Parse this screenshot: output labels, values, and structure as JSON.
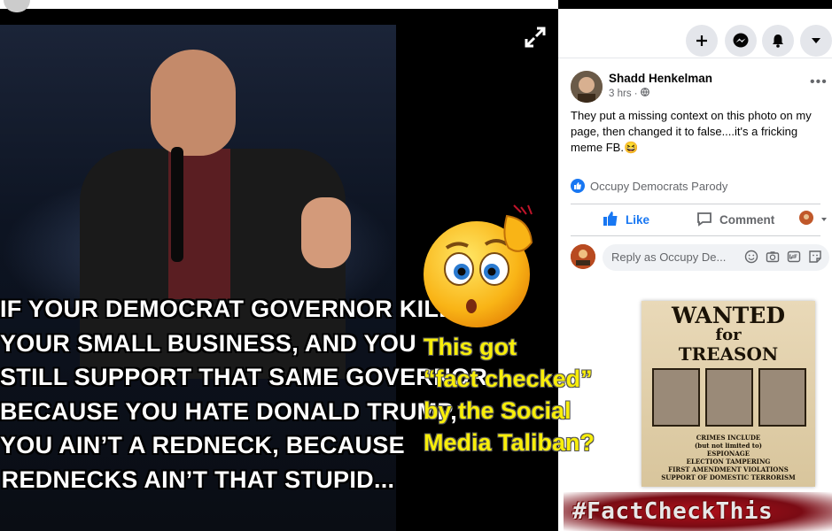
{
  "photo": {
    "meme_lines": [
      "IF YOUR DEMOCRAT GOVERNOR KILLED",
      "YOUR SMALL BUSINESS, AND YOU",
      "STILL SUPPORT THAT SAME GOVERNOR",
      "BECAUSE YOU HATE DONALD TRUMP,",
      "YOU AIN’T A REDNECK, BECAUSE",
      "REDNECKS AIN’T THAT STUPID..."
    ],
    "expand_icon": "expand-icon"
  },
  "topbar": {
    "icons": [
      "plus-icon",
      "messenger-icon",
      "bell-icon",
      "caret-down-icon"
    ]
  },
  "post": {
    "author": "Shadd Henkelman",
    "time": "3 hrs",
    "audience_icon": "globe-icon",
    "more_label": "•••",
    "caption": "They put a missing context on this photo on my page, then changed it to false....it's a fricking meme FB.😆",
    "reaction_name": "Occupy Democrats Parody",
    "actions": {
      "like": "Like",
      "comment": "Comment"
    },
    "reply_placeholder": "Reply as Occupy De...",
    "reply_icons": [
      "smiley-icon",
      "camera-icon",
      "gif-icon",
      "sticker-icon"
    ]
  },
  "overlay": {
    "claim_lines": [
      "This got",
      "“fact checked”",
      "by the Social",
      "Media Taliban?"
    ],
    "hashtag": "#FactCheckThis"
  },
  "poster": {
    "title": "WANTED",
    "for": "for",
    "treason": "TREASON",
    "lines": [
      "CRIMES INCLUDE",
      "(but not limited to)",
      "ESPIONAGE",
      "ELECTION TAMPERING",
      "FIRST AMENDMENT VIOLATIONS",
      "SUPPORT OF DOMESTIC TERRORISM"
    ]
  },
  "colors": {
    "facebook_blue": "#1877f2",
    "claim_yellow": "#f8ee0a",
    "hashtag_red": "#b0101a"
  }
}
